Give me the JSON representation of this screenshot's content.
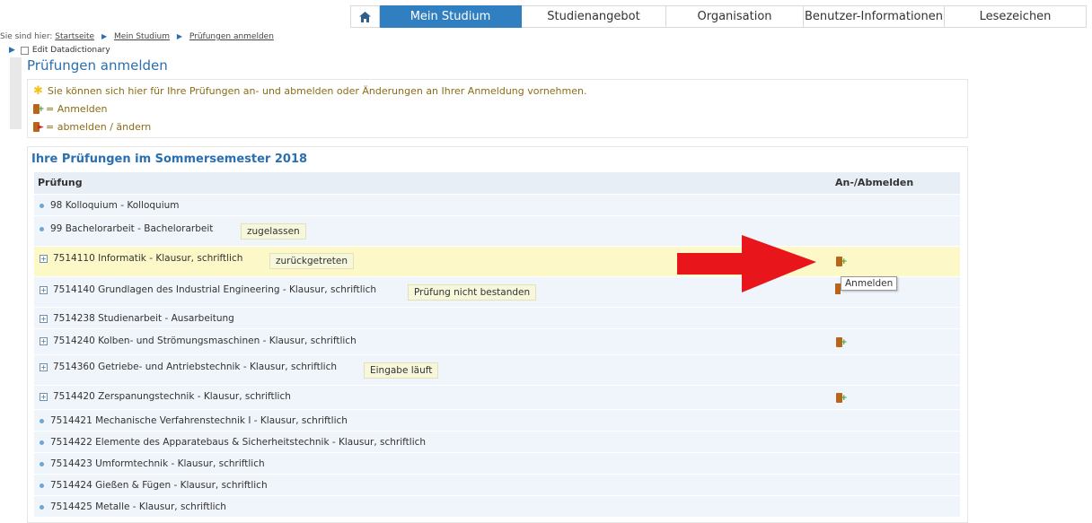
{
  "nav": {
    "items": [
      {
        "label": "Mein Studium",
        "active": true
      },
      {
        "label": "Studienangebot",
        "active": false
      },
      {
        "label": "Organisation",
        "active": false
      },
      {
        "label": "Benutzer-Informationen",
        "active": false
      },
      {
        "label": "Lesezeichen",
        "active": false
      }
    ],
    "home_icon": "home-icon",
    "active_color": "#2f7fc1"
  },
  "breadcrumb": {
    "prefix": "Sie sind hier:",
    "items": [
      "Startseite",
      "Mein Studium",
      "Prüfungen anmelden"
    ]
  },
  "datadictionary": {
    "label": "Edit Datadictionary"
  },
  "page": {
    "title": "Prüfungen anmelden"
  },
  "info": {
    "hint": "Sie können sich hier für Ihre Prüfungen an- und abmelden oder Änderungen an Ihrer Anmeldung vornehmen.",
    "legend_register": "= Anmelden",
    "legend_deregister": "= abmelden / ändern"
  },
  "exams": {
    "title": "Ihre Prüfungen im Sommersemester 2018",
    "columns": [
      "Prüfung",
      "An-/Abmelden"
    ],
    "rows": [
      {
        "label": "98 Kolloquium  -  Kolloquium",
        "marker": "bullet",
        "status": null,
        "icon": false
      },
      {
        "label": "99 Bachelorarbeit  -  Bachelorarbeit",
        "marker": "bullet",
        "status": "zugelassen",
        "icon": false
      },
      {
        "label": "7514110 Informatik  -  Klausur, schriftlich",
        "marker": "expand",
        "status": "zurückgetreten",
        "icon": true
      },
      {
        "label": "7514140 Grundlagen des Industrial Engineering  -  Klausur, schriftlich",
        "marker": "expand",
        "status": "Prüfung nicht bestanden",
        "icon": false
      },
      {
        "label": "7514238 Studienarbeit  -  Ausarbeitung",
        "marker": "expand",
        "status": null,
        "icon": false
      },
      {
        "label": "7514240 Kolben- und Strömungsmaschinen  -  Klausur, schriftlich",
        "marker": "expand",
        "status": null,
        "icon": true
      },
      {
        "label": "7514360 Getriebe- und Antriebstechnik  -  Klausur, schriftlich",
        "marker": "expand",
        "status": "Eingabe läuft",
        "icon": false
      },
      {
        "label": "7514420 Zerspanungstechnik  -  Klausur, schriftlich",
        "marker": "expand",
        "status": null,
        "icon": true
      },
      {
        "label": "7514421 Mechanische Verfahrenstechnik I  -  Klausur, schriftlich",
        "marker": "bullet",
        "status": null,
        "icon": false
      },
      {
        "label": "7514422 Elemente des Apparatebaus & Sicherheitstechnik  -  Klausur, schriftlich",
        "marker": "bullet",
        "status": null,
        "icon": false
      },
      {
        "label": "7514423 Umformtechnik  -  Klausur, schriftlich",
        "marker": "bullet",
        "status": null,
        "icon": false
      },
      {
        "label": "7514424 Gießen & Fügen  -  Klausur, schriftlich",
        "marker": "bullet",
        "status": null,
        "icon": false
      },
      {
        "label": "7514425 Metalle  -  Klausur, schriftlich",
        "marker": "bullet",
        "status": null,
        "icon": false
      }
    ]
  },
  "tooltip": {
    "text": "Anmelden"
  },
  "colors": {
    "link_blue": "#2a6fb0",
    "hint_text": "#8a6d12",
    "row_bg": "#f0f5fb",
    "highlight_bg": "#fdf8c8",
    "annotation_arrow": "#e8161b"
  }
}
